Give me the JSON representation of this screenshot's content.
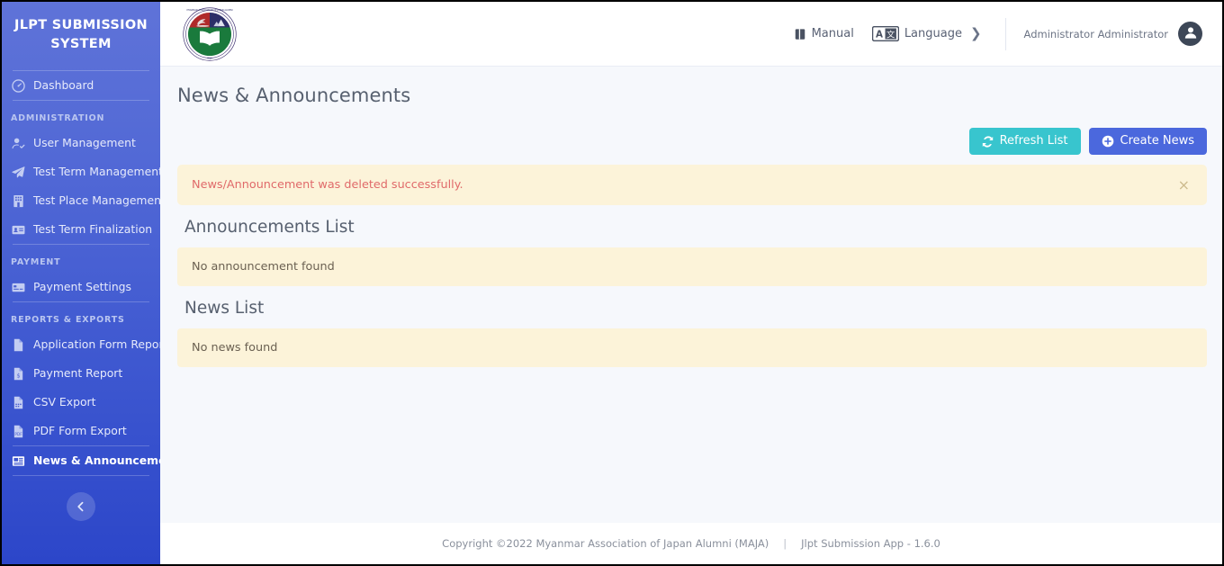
{
  "sidebar": {
    "brand_title": "JLPT SUBMISSION SYSTEM",
    "groups": [
      {
        "label": null,
        "items": [
          {
            "label": "Dashboard",
            "icon": "gauge-icon",
            "active": false
          }
        ]
      },
      {
        "label": "ADMINISTRATION",
        "items": [
          {
            "label": "User Management",
            "icon": "user-check-icon",
            "active": false
          },
          {
            "label": "Test Term Management",
            "icon": "paper-plane-icon",
            "active": false
          },
          {
            "label": "Test Place Management",
            "icon": "building-icon",
            "active": false
          },
          {
            "label": "Test Term Finalization",
            "icon": "id-card-icon",
            "active": false
          }
        ]
      },
      {
        "label": "PAYMENT",
        "items": [
          {
            "label": "Payment Settings",
            "icon": "credit-card-icon",
            "active": false
          }
        ]
      },
      {
        "label": "REPORTS & EXPORTS",
        "items": [
          {
            "label": "Application Form Report",
            "icon": "file-icon",
            "active": false
          },
          {
            "label": "Payment Report",
            "icon": "file-dollar-icon",
            "active": false
          },
          {
            "label": "CSV Export",
            "icon": "file-csv-icon",
            "active": false
          },
          {
            "label": "PDF Form Export",
            "icon": "file-pdf-icon",
            "active": false
          }
        ]
      },
      {
        "label": null,
        "items": [
          {
            "label": "News & Announcement",
            "icon": "newspaper-icon",
            "active": true
          }
        ]
      }
    ],
    "collapse_icon": "chevron-left-icon"
  },
  "topbar": {
    "logo_icon": "maja-logo-icon",
    "manual_label": "Manual",
    "manual_icon": "book-icon",
    "language_label": "Language",
    "language_icon": "translate-icon",
    "language_chevron": "❯",
    "user_name": "Administrator Administrator",
    "avatar_icon": "user-avatar-icon"
  },
  "content": {
    "page_title": "News & Announcements",
    "refresh_button": "Refresh List",
    "refresh_icon": "refresh-icon",
    "create_button": "Create News",
    "create_icon": "plus-circle-icon",
    "alert_message": "News/Announcement was deleted successfully.",
    "alert_close_icon": "×",
    "announcements_title": "Announcements List",
    "announcements_empty": "No announcement found",
    "news_title": "News List",
    "news_empty": "No news found"
  },
  "footer": {
    "copyright": "Copyright ©2022 Myanmar Association of Japan Alumni (MAJA)",
    "separator": "|",
    "app_version": "Jlpt Submission App - 1.6.0"
  },
  "colors": {
    "sidebar_top": "#5f73d8",
    "sidebar_bottom": "#2c46c9",
    "refresh_btn": "#38c5ce",
    "create_btn": "#4b68dd",
    "alert_bg": "#fcf3d9",
    "alert_text": "#e06a6a",
    "content_bg": "#f6f8fc"
  }
}
